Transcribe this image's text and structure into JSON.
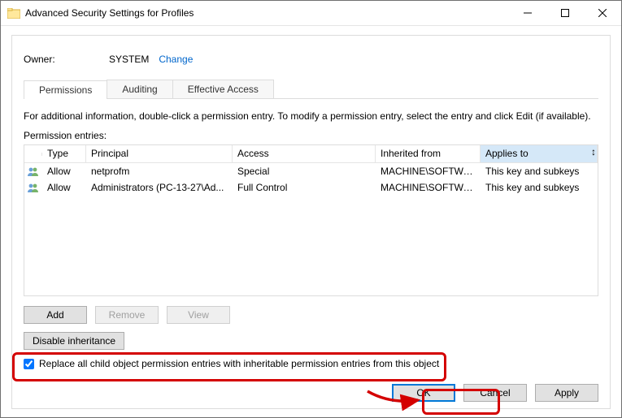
{
  "window": {
    "title": "Advanced Security Settings for Profiles"
  },
  "owner": {
    "label": "Owner:",
    "value": "SYSTEM",
    "change": "Change"
  },
  "tabs": {
    "permissions": "Permissions",
    "auditing": "Auditing",
    "effective": "Effective Access"
  },
  "info_text": "For additional information, double-click a permission entry. To modify a permission entry, select the entry and click Edit (if available).",
  "entries_label": "Permission entries:",
  "columns": {
    "type": "Type",
    "principal": "Principal",
    "access": "Access",
    "inherited": "Inherited from",
    "applies": "Applies to"
  },
  "rows": [
    {
      "type": "Allow",
      "principal": "netprofm",
      "access": "Special",
      "inherited": "MACHINE\\SOFTWARE...",
      "applies": "This key and subkeys"
    },
    {
      "type": "Allow",
      "principal": "Administrators (PC-13-27\\Ad...",
      "access": "Full Control",
      "inherited": "MACHINE\\SOFTWARE...",
      "applies": "This key and subkeys"
    }
  ],
  "buttons": {
    "add": "Add",
    "remove": "Remove",
    "view": "View",
    "disable_inheritance": "Disable inheritance",
    "ok": "OK",
    "cancel": "Cancel",
    "apply": "Apply"
  },
  "checkbox": {
    "label": "Replace all child object permission entries with inheritable permission entries from this object",
    "checked": true
  },
  "colors": {
    "highlight": "#d40000",
    "link": "#0066cc",
    "default_button_border": "#0078d7"
  }
}
